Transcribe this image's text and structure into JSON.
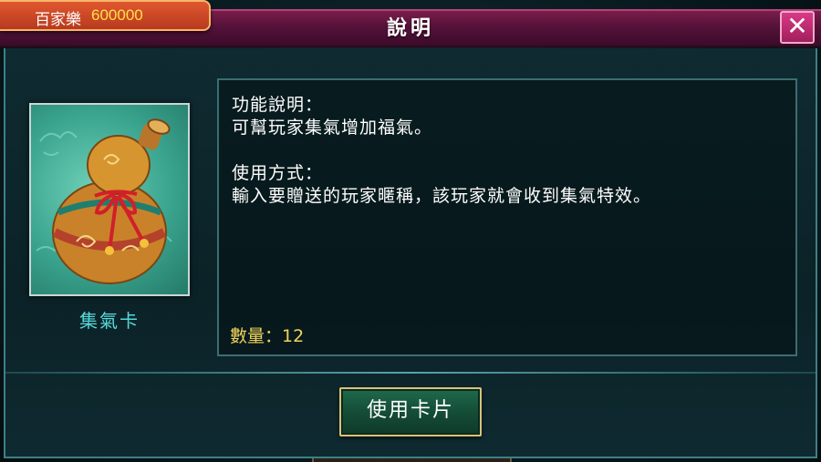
{
  "currency": {
    "label": "百家樂",
    "value": "600000"
  },
  "dialog": {
    "title": "說明",
    "close_label": "✕"
  },
  "item": {
    "name": "集氣卡",
    "icon": "gourd-icon"
  },
  "description": {
    "function_heading": "功能說明：",
    "function_text": "可幫玩家集氣增加福氣。",
    "usage_heading": "使用方式：",
    "usage_text": "輸入要贈送的玩家暱稱，該玩家就會收到集氣特效。",
    "quantity": "數量：12"
  },
  "actions": {
    "use_card_label": "使用卡片"
  },
  "colors": {
    "header": "#55123a",
    "panel": "#0f2b31",
    "accent": "#56d9d9",
    "quantity": "#f0d55a",
    "currency_value": "#ffe14a"
  }
}
